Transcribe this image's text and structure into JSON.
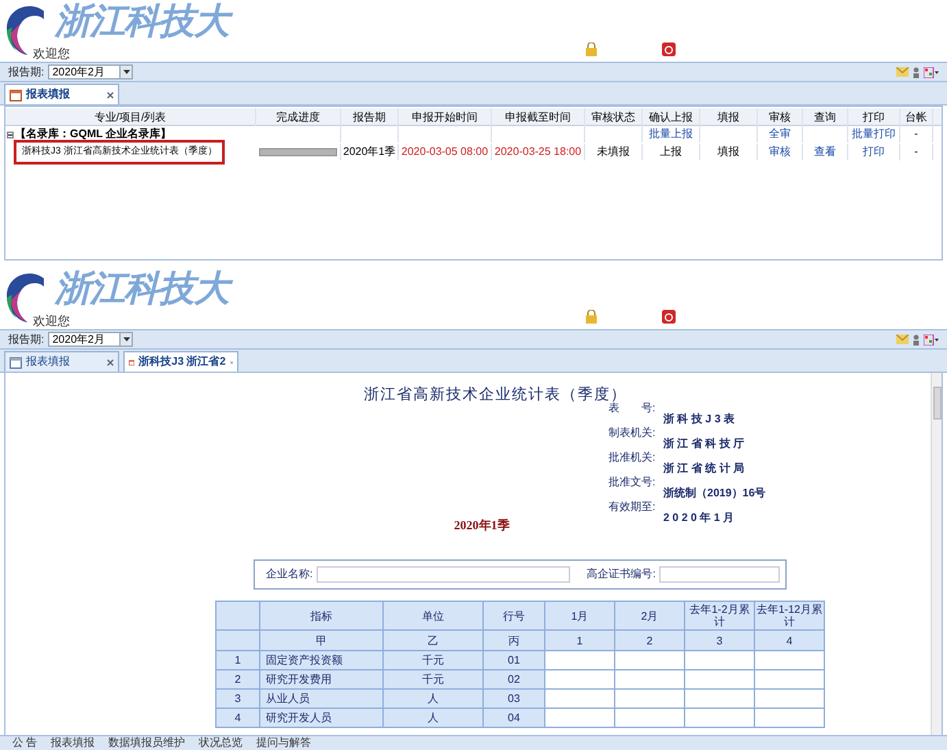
{
  "list_view": {
    "header": {
      "logo_text": "浙江科技大",
      "welcome": "欢迎您"
    },
    "period": {
      "label": "报告期:",
      "value": "2020年2月"
    },
    "tabs": [
      {
        "label": "报表填报",
        "selected": true
      }
    ],
    "table": {
      "columns": [
        "专业/项目/列表",
        "完成进度",
        "报告期",
        "申报开始时间",
        "申报截至时间",
        "审核状态",
        "确认上报",
        "填报",
        "审核",
        "查询",
        "打印",
        "台帐"
      ],
      "group": {
        "title": "【名录库：GQML 企业名录库】",
        "expanded": true,
        "confirm": "批量上报",
        "review": "全审",
        "print": "批量打印",
        "ledger": "-"
      },
      "rows": [
        {
          "name": "浙科技J3 浙江省高新技术企业统计表（季度）",
          "highlighted": true,
          "level": 1,
          "period": "2020年1季",
          "start": "2020-03-05 08:00",
          "end": "2020-03-25 18:00",
          "status": "未填报",
          "confirm": "上报",
          "fill": "填报",
          "review": "审核",
          "query": "查看",
          "print": "打印",
          "ledger": "-"
        }
      ]
    }
  },
  "form_view": {
    "header": {
      "logo_text": "浙江科技大",
      "welcome": "欢迎您"
    },
    "period": {
      "label": "报告期:",
      "value": "2020年2月"
    },
    "tabs": [
      {
        "label": "报表填报",
        "selected": false
      },
      {
        "label": "浙科技J3  浙江省2",
        "selected": true
      }
    ],
    "title": "浙江省高新技术企业统计表（季度）",
    "meta": [
      {
        "label": "表　　号:",
        "value": "浙 科 技 J 3 表"
      },
      {
        "label": "制表机关:",
        "value": "浙 江 省 科 技 厅"
      },
      {
        "label": "批准机关:",
        "value": "浙 江 省 统 计 局"
      },
      {
        "label": "批准文号:",
        "value": "浙统制（2019）16号"
      },
      {
        "label": "有效期至:",
        "value": "2 0 2 0 年 1 月"
      }
    ],
    "report_period": "2020年1季",
    "fields": [
      {
        "label": "企业名称:"
      },
      {
        "label": "高企证书编号:"
      }
    ],
    "table": {
      "columns": [
        "指标",
        "单位",
        "行号",
        "1月",
        "2月",
        "去年1-2月累计",
        "去年1-12月累计"
      ],
      "codes": [
        "甲",
        "乙",
        "丙",
        "1",
        "2",
        "3",
        "4"
      ],
      "rows": [
        {
          "no": "1",
          "name": "固定资产投资额",
          "unit": "千元",
          "line": "01"
        },
        {
          "no": "2",
          "name": "研究开发费用",
          "unit": "千元",
          "line": "02"
        },
        {
          "no": "3",
          "name": "从业人员",
          "unit": "人",
          "line": "03"
        },
        {
          "no": "4",
          "name": "研究开发人员",
          "unit": "人",
          "line": "04"
        }
      ]
    },
    "bottom_tabs": [
      "公 告",
      "报表填报",
      "数据填报员维护",
      "状况总览",
      "提问与解答"
    ]
  }
}
